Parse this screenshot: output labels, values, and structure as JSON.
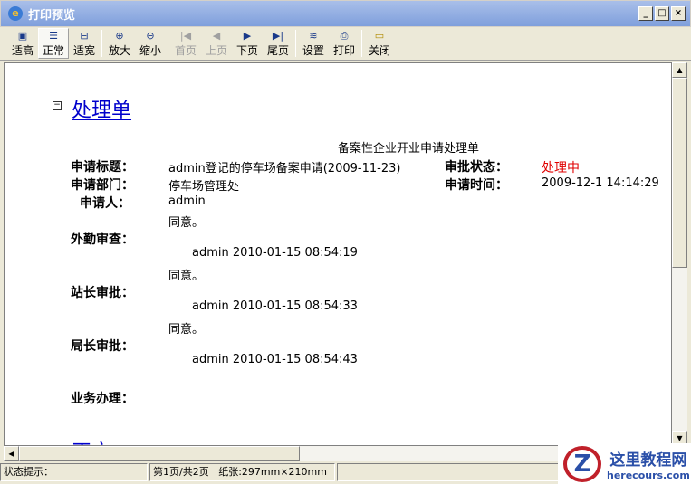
{
  "window": {
    "title": "打印预览"
  },
  "toolbar": [
    {
      "label": "适高",
      "icon": "fit-height-icon"
    },
    {
      "label": "正常",
      "icon": "normal-icon"
    },
    {
      "label": "适宽",
      "icon": "fit-width-icon"
    },
    {
      "label": "放大",
      "icon": "zoom-in-icon"
    },
    {
      "label": "缩小",
      "icon": "zoom-out-icon"
    },
    {
      "label": "首页",
      "icon": "first-page-icon"
    },
    {
      "label": "上页",
      "icon": "prev-page-icon"
    },
    {
      "label": "下页",
      "icon": "next-page-icon"
    },
    {
      "label": "尾页",
      "icon": "last-page-icon"
    },
    {
      "label": "设置",
      "icon": "settings-icon"
    },
    {
      "label": "打印",
      "icon": "print-icon"
    },
    {
      "label": "关闭",
      "icon": "close-folder-icon"
    }
  ],
  "doc": {
    "heading": "处理单",
    "heading2": "正文",
    "subtitle": "备案性企业开业申请处理单",
    "title_label": "申请标题：",
    "title_value": "admin登记的停车场备案申请(2009-11-23)",
    "status_label": "审批状态：",
    "status_value": "处理中",
    "dept_label": "申请部门：",
    "dept_value": "停车场管理处",
    "time_label": "申请时间：",
    "time_value": "2009-12-1 14:14:29",
    "applicant_label": "申请人：",
    "applicant_value": "admin",
    "steps": [
      {
        "label": "外勤审查：",
        "opinion": "同意。",
        "sign": "admin 2010-01-15 08:54:19"
      },
      {
        "label": "站长审批：",
        "opinion": "同意。",
        "sign": "admin 2010-01-15 08:54:33"
      },
      {
        "label": "局长审批：",
        "opinion": "同意。",
        "sign": "admin 2010-01-15 08:54:43"
      }
    ],
    "business_label": "业务办理："
  },
  "status": {
    "hint": "状态提示：",
    "page": "第1页/共2页",
    "paper": "纸张:297mm×210mm"
  },
  "watermark": {
    "name": "这里教程网",
    "url": "herecours.com"
  },
  "colors": {
    "status": "#e00000",
    "heading": "#0000cc"
  }
}
